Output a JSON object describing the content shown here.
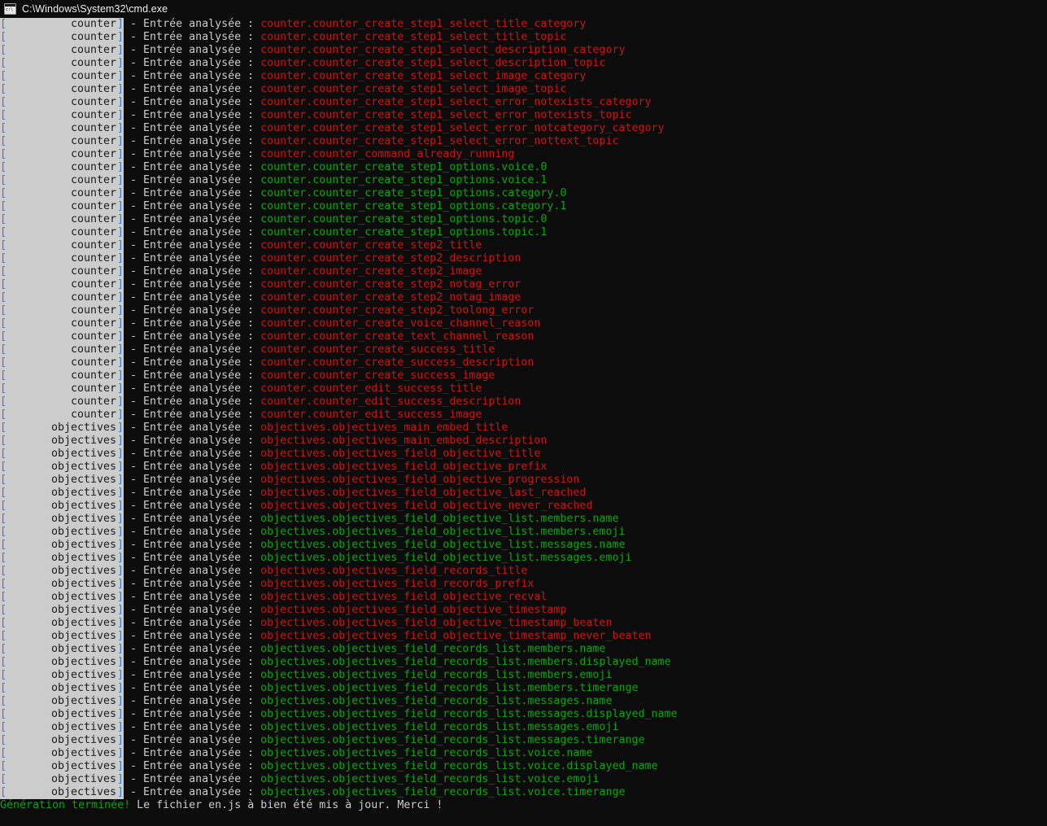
{
  "window": {
    "title": "C:\\Windows\\System32\\cmd.exe",
    "icon": "cmd-console-icon"
  },
  "console": {
    "prefix_open": "[",
    "prefix_close": "]",
    "separator": " - Entrée analysée : ",
    "colors": {
      "background": "#0c0c0c",
      "tag_background": "#cccccc",
      "tag_text": "#1c1c1c",
      "bracket": "#3b78c4",
      "separator_text": "#cccccc",
      "key_red": "#c01818",
      "key_green": "#12a013"
    },
    "lines": [
      {
        "tag": "counter",
        "key": "counter.counter_create_step1_select_title_category",
        "color": "red"
      },
      {
        "tag": "counter",
        "key": "counter.counter_create_step1_select_title_topic",
        "color": "red"
      },
      {
        "tag": "counter",
        "key": "counter.counter_create_step1_select_description_category",
        "color": "red"
      },
      {
        "tag": "counter",
        "key": "counter.counter_create_step1_select_description_topic",
        "color": "red"
      },
      {
        "tag": "counter",
        "key": "counter.counter_create_step1_select_image_category",
        "color": "red"
      },
      {
        "tag": "counter",
        "key": "counter.counter_create_step1_select_image_topic",
        "color": "red"
      },
      {
        "tag": "counter",
        "key": "counter.counter_create_step1_select_error_notexists_category",
        "color": "red"
      },
      {
        "tag": "counter",
        "key": "counter.counter_create_step1_select_error_notexists_topic",
        "color": "red"
      },
      {
        "tag": "counter",
        "key": "counter.counter_create_step1_select_error_notcategory_category",
        "color": "red"
      },
      {
        "tag": "counter",
        "key": "counter.counter_create_step1_select_error_nottext_topic",
        "color": "red"
      },
      {
        "tag": "counter",
        "key": "counter.counter_command_already_running",
        "color": "red"
      },
      {
        "tag": "counter",
        "key": "counter.counter_create_step1_options.voice.0",
        "color": "green"
      },
      {
        "tag": "counter",
        "key": "counter.counter_create_step1_options.voice.1",
        "color": "green"
      },
      {
        "tag": "counter",
        "key": "counter.counter_create_step1_options.category.0",
        "color": "green"
      },
      {
        "tag": "counter",
        "key": "counter.counter_create_step1_options.category.1",
        "color": "green"
      },
      {
        "tag": "counter",
        "key": "counter.counter_create_step1_options.topic.0",
        "color": "green"
      },
      {
        "tag": "counter",
        "key": "counter.counter_create_step1_options.topic.1",
        "color": "green"
      },
      {
        "tag": "counter",
        "key": "counter.counter_create_step2_title",
        "color": "red"
      },
      {
        "tag": "counter",
        "key": "counter.counter_create_step2_description",
        "color": "red"
      },
      {
        "tag": "counter",
        "key": "counter.counter_create_step2_image",
        "color": "red"
      },
      {
        "tag": "counter",
        "key": "counter.counter_create_step2_notag_error",
        "color": "red"
      },
      {
        "tag": "counter",
        "key": "counter.counter_create_step2_notag_image",
        "color": "red"
      },
      {
        "tag": "counter",
        "key": "counter.counter_create_step2_toolong_error",
        "color": "red"
      },
      {
        "tag": "counter",
        "key": "counter.counter_create_voice_channel_reason",
        "color": "red"
      },
      {
        "tag": "counter",
        "key": "counter.counter_create_text_channel_reason",
        "color": "red"
      },
      {
        "tag": "counter",
        "key": "counter.counter_create_success_title",
        "color": "red"
      },
      {
        "tag": "counter",
        "key": "counter.counter_create_success_description",
        "color": "red"
      },
      {
        "tag": "counter",
        "key": "counter.counter_create_success_image",
        "color": "red"
      },
      {
        "tag": "counter",
        "key": "counter.counter_edit_success_title",
        "color": "red"
      },
      {
        "tag": "counter",
        "key": "counter.counter_edit_success_description",
        "color": "red"
      },
      {
        "tag": "counter",
        "key": "counter.counter_edit_success_image",
        "color": "red"
      },
      {
        "tag": "objectives",
        "key": "objectives.objectives_main_embed_title",
        "color": "red"
      },
      {
        "tag": "objectives",
        "key": "objectives.objectives_main_embed_description",
        "color": "red"
      },
      {
        "tag": "objectives",
        "key": "objectives.objectives_field_objective_title",
        "color": "red"
      },
      {
        "tag": "objectives",
        "key": "objectives.objectives_field_objective_prefix",
        "color": "red"
      },
      {
        "tag": "objectives",
        "key": "objectives.objectives_field_objective_progression",
        "color": "red"
      },
      {
        "tag": "objectives",
        "key": "objectives.objectives_field_objective_last_reached",
        "color": "red"
      },
      {
        "tag": "objectives",
        "key": "objectives.objectives_field_objective_never_reached",
        "color": "red"
      },
      {
        "tag": "objectives",
        "key": "objectives.objectives_field_objective_list.members.name",
        "color": "green"
      },
      {
        "tag": "objectives",
        "key": "objectives.objectives_field_objective_list.members.emoji",
        "color": "green"
      },
      {
        "tag": "objectives",
        "key": "objectives.objectives_field_objective_list.messages.name",
        "color": "green"
      },
      {
        "tag": "objectives",
        "key": "objectives.objectives_field_objective_list.messages.emoji",
        "color": "green"
      },
      {
        "tag": "objectives",
        "key": "objectives.objectives_field_records_title",
        "color": "red"
      },
      {
        "tag": "objectives",
        "key": "objectives.objectives_field_records_prefix",
        "color": "red"
      },
      {
        "tag": "objectives",
        "key": "objectives.objectives_field_objective_recval",
        "color": "red"
      },
      {
        "tag": "objectives",
        "key": "objectives.objectives_field_objective_timestamp",
        "color": "red"
      },
      {
        "tag": "objectives",
        "key": "objectives.objectives_field_objective_timestamp_beaten",
        "color": "red"
      },
      {
        "tag": "objectives",
        "key": "objectives.objectives_field_objective_timestamp_never_beaten",
        "color": "red"
      },
      {
        "tag": "objectives",
        "key": "objectives.objectives_field_records_list.members.name",
        "color": "green"
      },
      {
        "tag": "objectives",
        "key": "objectives.objectives_field_records_list.members.displayed_name",
        "color": "green"
      },
      {
        "tag": "objectives",
        "key": "objectives.objectives_field_records_list.members.emoji",
        "color": "green"
      },
      {
        "tag": "objectives",
        "key": "objectives.objectives_field_records_list.members.timerange",
        "color": "green"
      },
      {
        "tag": "objectives",
        "key": "objectives.objectives_field_records_list.messages.name",
        "color": "green"
      },
      {
        "tag": "objectives",
        "key": "objectives.objectives_field_records_list.messages.displayed_name",
        "color": "green"
      },
      {
        "tag": "objectives",
        "key": "objectives.objectives_field_records_list.messages.emoji",
        "color": "green"
      },
      {
        "tag": "objectives",
        "key": "objectives.objectives_field_records_list.messages.timerange",
        "color": "green"
      },
      {
        "tag": "objectives",
        "key": "objectives.objectives_field_records_list.voice.name",
        "color": "green"
      },
      {
        "tag": "objectives",
        "key": "objectives.objectives_field_records_list.voice.displayed_name",
        "color": "green"
      },
      {
        "tag": "objectives",
        "key": "objectives.objectives_field_records_list.voice.emoji",
        "color": "green"
      },
      {
        "tag": "objectives",
        "key": "objectives.objectives_field_records_list.voice.timerange",
        "color": "green"
      }
    ],
    "status_line": {
      "highlight": "Génération terminée!",
      "rest": " Le fichier en.js à bien été mis à jour. Merci !"
    }
  }
}
